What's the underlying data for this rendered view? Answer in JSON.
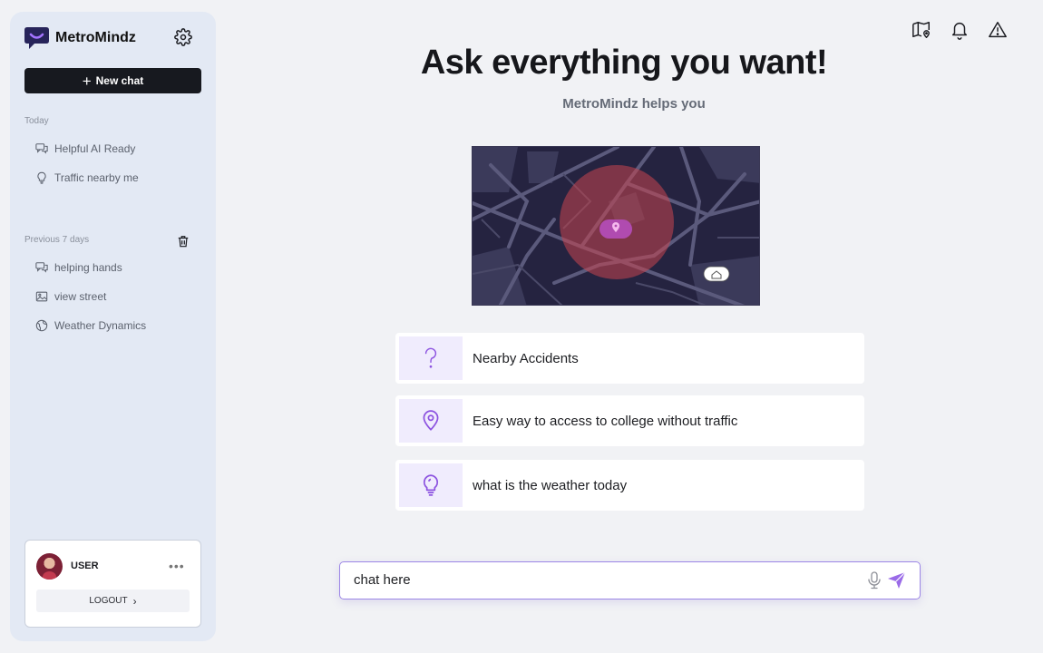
{
  "brand": {
    "name": "MetroMindz",
    "accent": "#8c52e0"
  },
  "sidebar": {
    "new_chat_label": "New chat",
    "today_label": "Today",
    "today_items": [
      {
        "label": "Helpful AI Ready",
        "icon": "chat-bubbles-icon"
      },
      {
        "label": "Traffic nearby me",
        "icon": "lightbulb-icon"
      }
    ],
    "previous_label": "Previous 7 days",
    "previous_items": [
      {
        "label": "helping hands",
        "icon": "chat-bubbles-icon"
      },
      {
        "label": "view street",
        "icon": "image-icon"
      },
      {
        "label": "Weather Dynamics",
        "icon": "globe-icon"
      }
    ]
  },
  "user": {
    "name": "USER",
    "logout_label": "LOGOUT"
  },
  "hero": {
    "title": "Ask everything you want!",
    "subtitle": "MetroMindz  helps you"
  },
  "suggestions": [
    {
      "label": "Nearby Accidents",
      "icon": "question-icon"
    },
    {
      "label": "Easy way to access to college without traffic",
      "icon": "location-pin-icon"
    },
    {
      "label": "what is the weather today",
      "icon": "lightbulb-icon"
    }
  ],
  "chat": {
    "placeholder": "chat here"
  },
  "colors": {
    "sidebar_bg": "#e3e9f4",
    "dark_button": "#17191f",
    "map_bg": "#252340",
    "alert_zone": "#c9464f"
  }
}
